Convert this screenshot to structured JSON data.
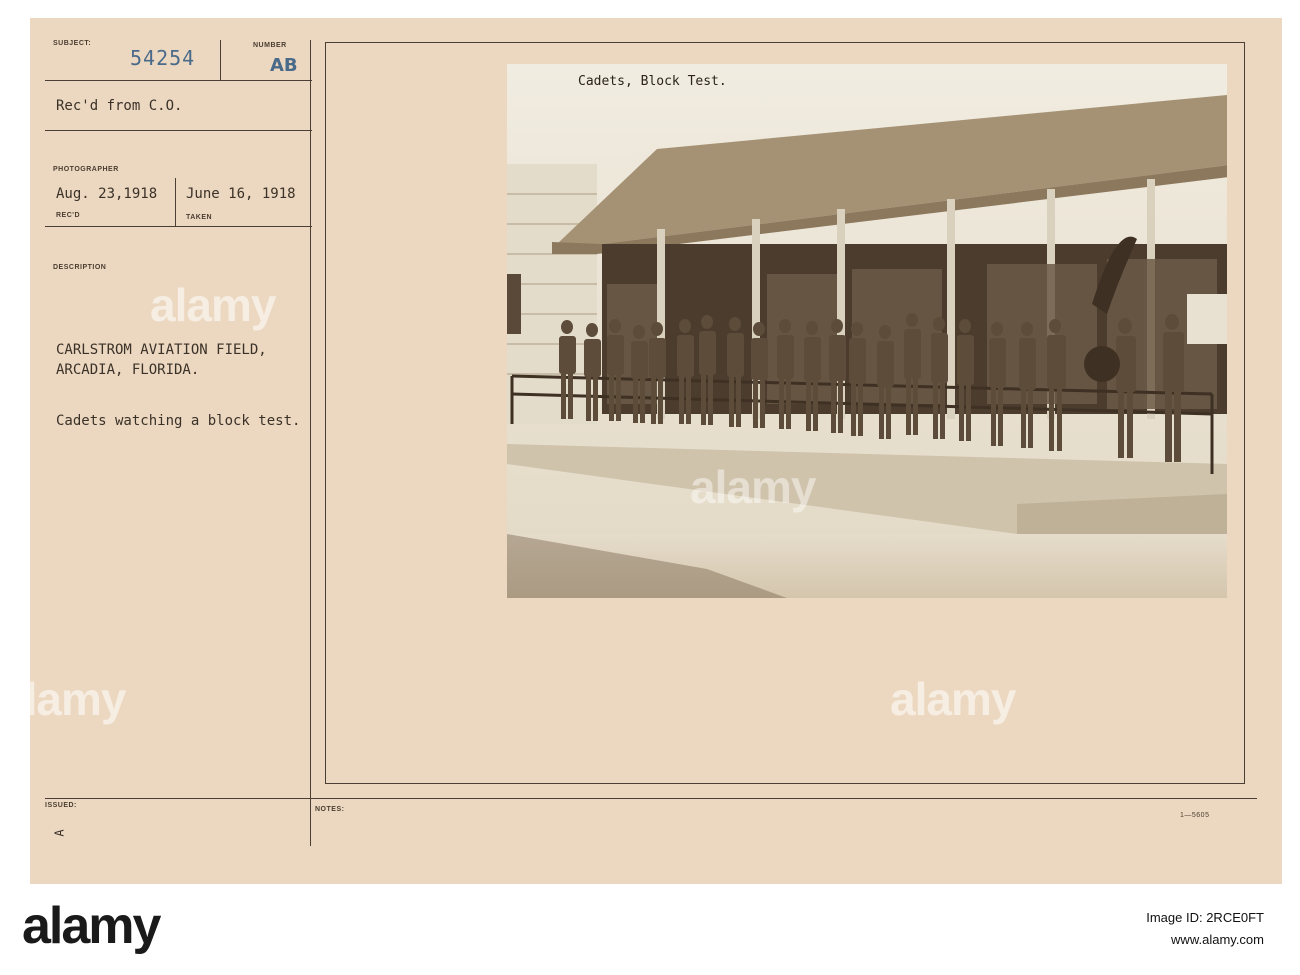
{
  "card": {
    "subject_label": "SUBJECT:",
    "subject_number": "54254",
    "number_label": "NUMBER",
    "number_value": "AB",
    "recd_from": "Rec'd from C.O.",
    "photographer_label": "PHOTOGRAPHER",
    "recd_date": "Aug. 23,1918",
    "taken_date": "June 16, 1918",
    "recd_label": "REC'D",
    "taken_label": "TAKEN",
    "description_label": "DESCRIPTION",
    "description_line1": "CARLSTROM AVIATION FIELD,",
    "description_line2": "ARCADIA, FLORIDA.",
    "description_line3": "Cadets watching a block test.",
    "issued_label": "ISSUED:",
    "notes_label": "NOTES:",
    "issued_mark": "A",
    "form_code": "1—5605",
    "photo_caption": "Cadets, Block Test."
  },
  "watermark": "alamy",
  "footer": {
    "logo": "alamy",
    "image_id_label": "Image ID: 2RCE0FT",
    "site": "www.alamy.com"
  },
  "colors": {
    "card": "#ecd8c0",
    "ink": "#3a3128",
    "stamp_blue": "#4a6a8a",
    "photo_sepia": "#7a6650"
  }
}
